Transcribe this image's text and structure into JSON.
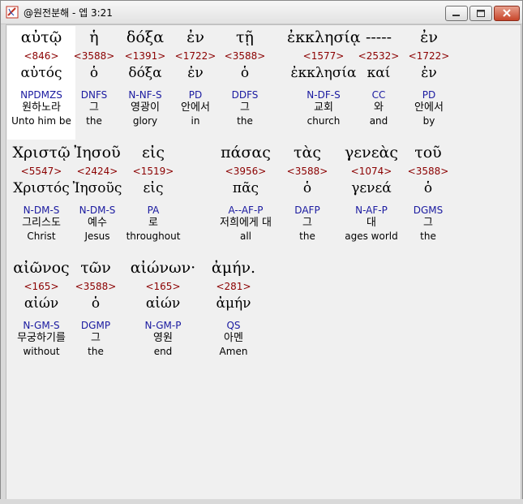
{
  "window": {
    "title": "@원전분해 - 엡 3:21",
    "buttons": {
      "minimize": "minimize",
      "maximize": "maximize",
      "close": "close"
    }
  },
  "verse_rows": [
    [
      {
        "greek": "αὐτῷ",
        "strong": "<846>",
        "lemma": "αὐτός",
        "parse": "NPDMZS",
        "korean": "원하노라",
        "english": "Unto him be"
      },
      {
        "greek": "ἡ",
        "strong": "<3588>",
        "lemma": "ὁ",
        "parse": "DNFS",
        "korean": "그",
        "english": "the"
      },
      {
        "greek": "δόξα",
        "strong": "<1391>",
        "lemma": "δόξα",
        "parse": "N-NF-S",
        "korean": "영광이",
        "english": "glory"
      },
      {
        "greek": "ἐν",
        "strong": "<1722>",
        "lemma": "ἐν",
        "parse": "PD",
        "korean": "안에서",
        "english": "in"
      },
      {
        "greek": "τῇ",
        "strong": "<3588>",
        "lemma": "ὁ",
        "parse": "DDFS",
        "korean": "그",
        "english": "the"
      },
      {
        "greek": "ἐκκλησίᾳ",
        "strong": "<1577>",
        "lemma": "ἐκκλησία",
        "parse": "N-DF-S",
        "korean": "교회",
        "english": "church"
      },
      {
        "greek": "-----",
        "strong": "<2532>",
        "lemma": "καί",
        "parse": "CC",
        "korean": "와",
        "english": "and"
      },
      {
        "greek": "ἐν",
        "strong": "<1722>",
        "lemma": "ἐν",
        "parse": "PD",
        "korean": "안에서",
        "english": "by"
      }
    ],
    [
      {
        "greek": "Χριστῷ",
        "strong": "<5547>",
        "lemma": "Χριστός",
        "parse": "N-DM-S",
        "korean": "그리스도",
        "english": "Christ"
      },
      {
        "greek": "Ἰησοῦ",
        "strong": "<2424>",
        "lemma": "Ἰησοῦς",
        "parse": "N-DM-S",
        "korean": "예수",
        "english": "Jesus"
      },
      {
        "greek": "εἰς",
        "strong": "<1519>",
        "lemma": "εἰς",
        "parse": "PA",
        "korean": "로",
        "english": "throughout"
      },
      {
        "greek": "πάσας",
        "strong": "<3956>",
        "lemma": "πᾶς",
        "parse": "A--AF-P",
        "korean": "저희에게 대",
        "english": "all"
      },
      {
        "greek": "τὰς",
        "strong": "<3588>",
        "lemma": "ὁ",
        "parse": "DAFP",
        "korean": "그",
        "english": "the"
      },
      {
        "greek": "γενεὰς",
        "strong": "<1074>",
        "lemma": "γενεά",
        "parse": "N-AF-P",
        "korean": "대",
        "english": "ages world"
      },
      {
        "greek": "τοῦ",
        "strong": "<3588>",
        "lemma": "ὁ",
        "parse": "DGMS",
        "korean": "그",
        "english": "the"
      }
    ],
    [
      {
        "greek": "αἰῶνος",
        "strong": "<165>",
        "lemma": "αἰών",
        "parse": "N-GM-S",
        "korean": "무궁하기를",
        "english": "without"
      },
      {
        "greek": "τῶν",
        "strong": "<3588>",
        "lemma": "ὁ",
        "parse": "DGMP",
        "korean": "그",
        "english": "the"
      },
      {
        "greek": "αἰώνων·",
        "strong": "<165>",
        "lemma": "αἰών",
        "parse": "N-GM-P",
        "korean": "영원",
        "english": "end"
      },
      {
        "greek": "ἀμήν.",
        "strong": "<281>",
        "lemma": "ἀμήν",
        "parse": "QS",
        "korean": "아멘",
        "english": "Amen"
      }
    ]
  ]
}
